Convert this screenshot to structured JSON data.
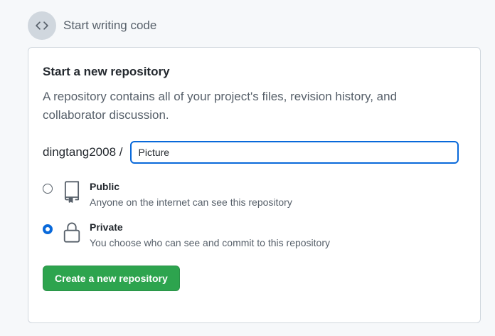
{
  "header": {
    "title": "Start writing code",
    "icon": "code-icon"
  },
  "card": {
    "title": "Start a new repository",
    "description": "A repository contains all of your project's files, revision history, and collaborator discussion."
  },
  "form": {
    "owner": "dingtang2008 /",
    "repo_name_value": "Picture"
  },
  "visibility": {
    "selected": "private",
    "options": [
      {
        "label": "Public",
        "description": "Anyone on the internet can see this repository",
        "icon": "repo-icon"
      },
      {
        "label": "Private",
        "description": "You choose who can see and commit to this repository",
        "icon": "lock-icon"
      }
    ]
  },
  "actions": {
    "create_label": "Create a new repository"
  },
  "colors": {
    "accent": "#0969da",
    "primary_button": "#2da44e",
    "background": "#f6f8fa"
  }
}
